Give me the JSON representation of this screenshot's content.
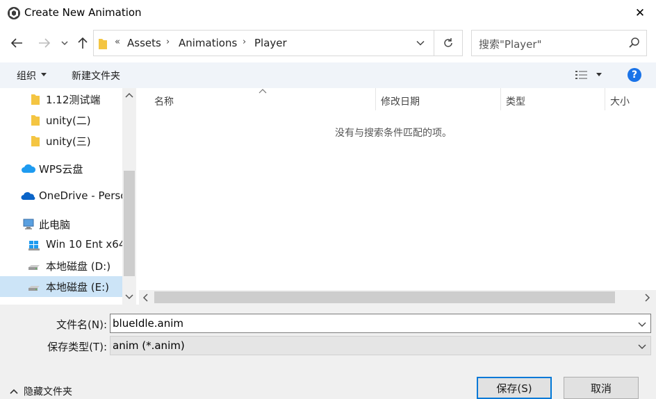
{
  "window": {
    "title": "Create New Animation",
    "close_symbol": "✕"
  },
  "nav": {
    "breadcrumb_prefix": "«",
    "breadcrumbs": [
      "Assets",
      "Animations",
      "Player"
    ],
    "search_placeholder": "搜索\"Player\""
  },
  "toolbar": {
    "organize_label": "组织",
    "new_folder_label": "新建文件夹",
    "help_symbol": "?"
  },
  "sidebar": {
    "items": [
      {
        "label": "1.12测试端",
        "icon": "folder-icon"
      },
      {
        "label": "unity(二)",
        "icon": "folder-icon"
      },
      {
        "label": "unity(三)",
        "icon": "folder-icon"
      },
      {
        "label": "WPS云盘",
        "icon": "cloud-icon"
      },
      {
        "label": "OneDrive - Perso",
        "icon": "onedrive-icon"
      },
      {
        "label": "此电脑",
        "icon": "computer-icon"
      },
      {
        "label": "Win 10 Ent x64",
        "icon": "windows-drive-icon"
      },
      {
        "label": "本地磁盘 (D:)",
        "icon": "disk-icon"
      },
      {
        "label": "本地磁盘 (E:)",
        "icon": "disk-icon",
        "selected": true
      }
    ]
  },
  "file_list": {
    "columns": [
      "名称",
      "修改日期",
      "类型",
      "大小"
    ],
    "empty_message": "没有与搜索条件匹配的项。"
  },
  "form": {
    "filename_label": "文件名(N):",
    "filename_value": "blueIdle.anim",
    "filetype_label": "保存类型(T):",
    "filetype_value": "anim (*.anim)"
  },
  "footer": {
    "hide_folders_label": "隐藏文件夹",
    "save_label": "保存(S)",
    "cancel_label": "取消"
  },
  "colors": {
    "accent": "#0078d7",
    "selection": "#cce4f7",
    "toolbar_bg": "#f0f4f9",
    "folder": "#f4c542",
    "help": "#1a73e8"
  }
}
